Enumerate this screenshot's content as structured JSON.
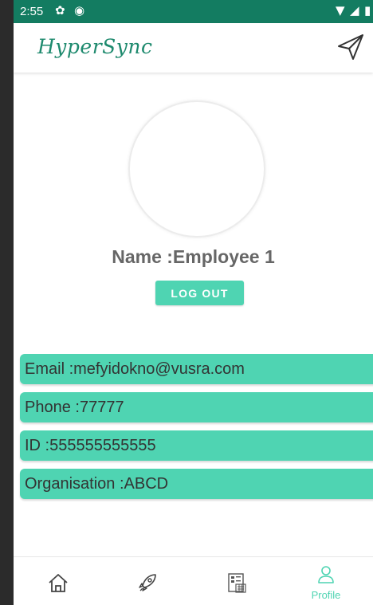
{
  "status_bar": {
    "time": "2:55"
  },
  "app_bar": {
    "title": "HyperSync"
  },
  "profile": {
    "name_text": "Name :Employee 1",
    "logout_label": "LOG OUT"
  },
  "info": {
    "email": "Email :mefyidokno@vusra.com",
    "phone": "Phone :77777",
    "id": "ID :555555555555",
    "organisation": "Organisation :ABCD"
  },
  "bottom_nav": {
    "items": [
      {
        "icon": "home-icon",
        "label": ""
      },
      {
        "icon": "rocket-icon",
        "label": ""
      },
      {
        "icon": "calendar-grid-icon",
        "label": ""
      },
      {
        "icon": "profile-icon",
        "label": "Profile"
      }
    ]
  },
  "colors": {
    "status_bar": "#137c61",
    "accent": "#4fd4b2",
    "title": "#1e8a6e",
    "frame": "#2b2b2b"
  }
}
